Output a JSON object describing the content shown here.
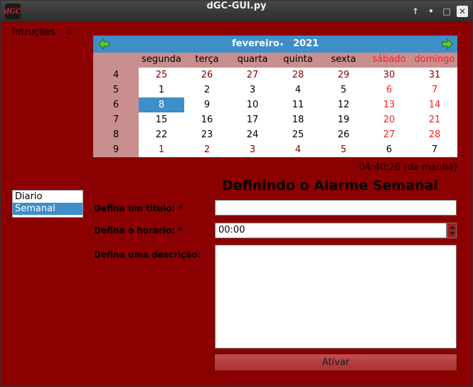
{
  "window": {
    "title": "dGC-GUI.py",
    "icon_text": "dGC",
    "controls": [
      "up-icon",
      "dot-icon",
      "maximize-icon",
      "close-icon"
    ]
  },
  "menu": {
    "label": "Intruções",
    "more": "»"
  },
  "calendar": {
    "month": "fevereiro",
    "year": "2021",
    "weekdays": [
      "segunda",
      "terça",
      "quarta",
      "quinta",
      "sexta",
      "sábado",
      "domingo"
    ],
    "weeks": [
      {
        "num": "4",
        "days": [
          "25",
          "26",
          "27",
          "28",
          "29",
          "30",
          "31"
        ]
      },
      {
        "num": "5",
        "days": [
          "1",
          "2",
          "3",
          "4",
          "5",
          "6",
          "7"
        ]
      },
      {
        "num": "6",
        "days": [
          "8",
          "9",
          "10",
          "11",
          "12",
          "13",
          "14"
        ]
      },
      {
        "num": "7",
        "days": [
          "15",
          "16",
          "17",
          "18",
          "19",
          "20",
          "21"
        ]
      },
      {
        "num": "8",
        "days": [
          "22",
          "23",
          "24",
          "25",
          "26",
          "27",
          "28"
        ]
      },
      {
        "num": "9",
        "days": [
          "1",
          "2",
          "3",
          "4",
          "5",
          "6",
          "7"
        ]
      }
    ],
    "selected": "8",
    "colors": {
      "header": "#3d8ec9",
      "weekend": "#ff1f1f",
      "accent": "#8b0000"
    }
  },
  "clock": "04:40:26 (da manhã)",
  "sidebar": {
    "items": [
      "Diario",
      "Semanal"
    ],
    "active": "Semanal"
  },
  "form": {
    "heading": "Definindo o Alarme Semanal",
    "title_label": "Defina um titulo: *",
    "title_value": "",
    "time_label": "Defina o horario: *",
    "time_value": "00:00",
    "desc_label": "Defina uma descrição:",
    "desc_value": "",
    "submit": "Ativar"
  }
}
